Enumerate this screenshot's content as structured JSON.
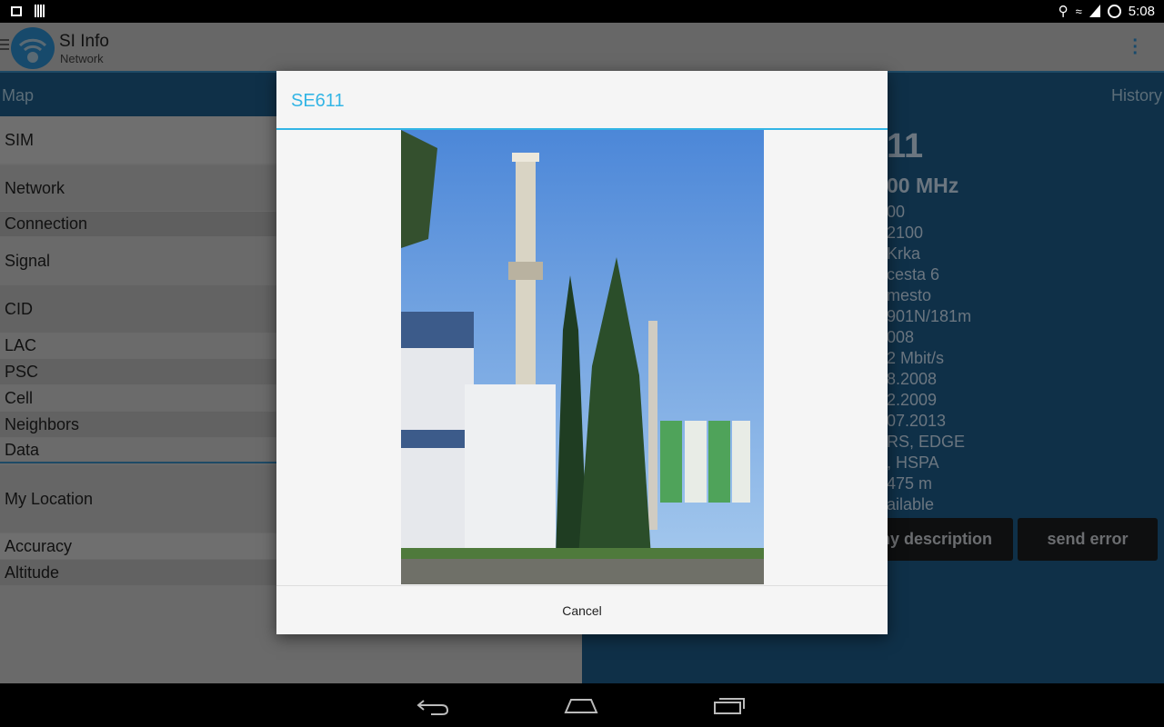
{
  "status_bar": {
    "time": "5:08",
    "icons": [
      "image-icon",
      "barcode-icon",
      "location-icon",
      "wifi-icon",
      "signal-icon",
      "sync-icon"
    ]
  },
  "app_bar": {
    "title": "SI Info",
    "subtitle": "Network"
  },
  "tabs": {
    "left": "Map",
    "right": "History"
  },
  "left_list": [
    "SIM",
    "Network",
    "Connection",
    "Signal",
    "CID",
    "LAC",
    "PSC",
    "Cell",
    "Neighbors",
    "Data",
    "My Location",
    "Accuracy",
    "Altitude"
  ],
  "right_panel": {
    "heading": "11",
    "subheading": "00 MHz",
    "values": [
      "00",
      "2100",
      "Krka",
      "cesta 6",
      "mesto",
      "901N/181m",
      "008",
      "2 Mbit/s",
      "8.2008",
      "2.2009",
      "07.2013",
      "RS, EDGE",
      ", HSPA",
      "475 m",
      "ailable"
    ],
    "buttons": {
      "description": "my description",
      "send_error": "send error"
    }
  },
  "dialog": {
    "title": "SE611",
    "cancel": "Cancel"
  },
  "colors": {
    "accent": "#33b5e5",
    "panel": "#0f3048"
  }
}
